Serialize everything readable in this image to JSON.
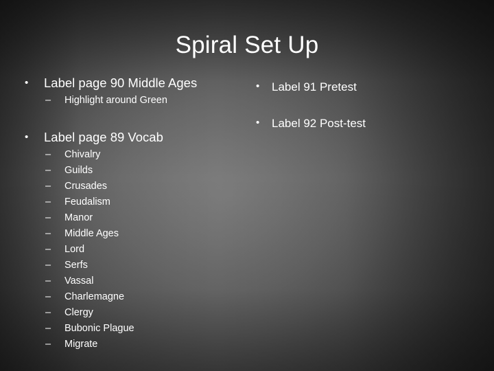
{
  "slide": {
    "title": "Spiral Set Up",
    "background": {
      "center_color": "#7d7d7d",
      "edge_color": "#1b1b1b",
      "text_color": "#ffffff"
    },
    "markers": {
      "level1": "•",
      "level2": "–"
    },
    "columns": {
      "left": {
        "blocks": [
          {
            "heading": "Label page 90 Middle Ages",
            "subitems": [
              "Highlight around Green"
            ]
          },
          {
            "heading": "Label page 89 Vocab",
            "subitems": [
              "Chivalry",
              "Guilds",
              "Crusades",
              "Feudalism",
              "Manor",
              "Middle Ages",
              "Lord",
              "Serfs",
              "Vassal",
              "Charlemagne",
              "Clergy",
              "Bubonic Plague",
              "Migrate"
            ]
          }
        ]
      },
      "right": {
        "items": [
          "Label 91 Pretest",
          "Label 92 Post-test"
        ]
      }
    }
  }
}
